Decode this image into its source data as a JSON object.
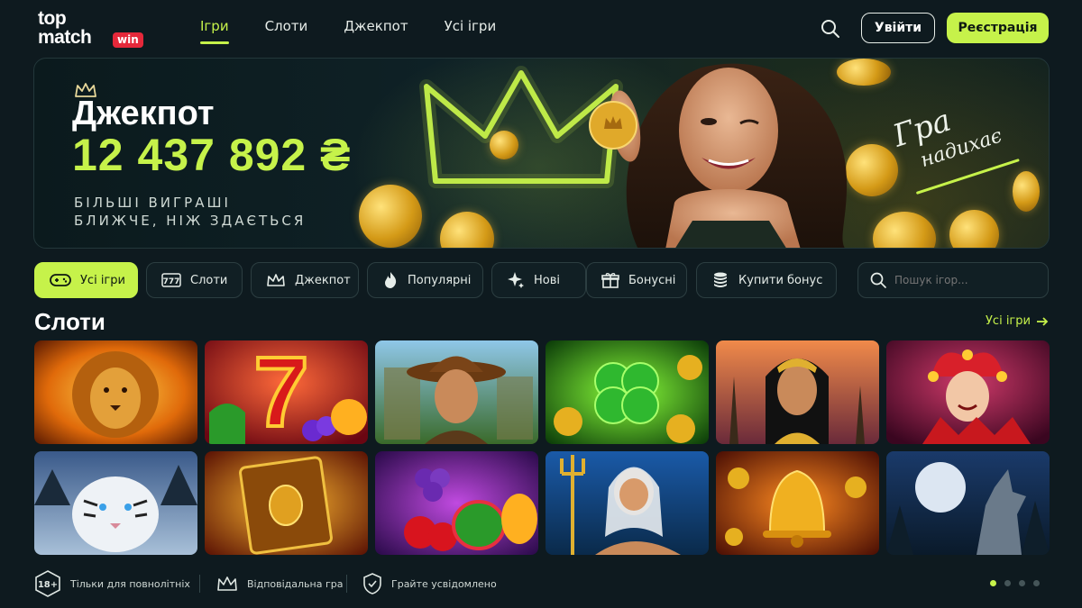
{
  "brand": {
    "top": "top",
    "bottom": "match",
    "badge": "win"
  },
  "nav": [
    {
      "label": "Ігри",
      "active": true
    },
    {
      "label": "Слоти",
      "active": false
    },
    {
      "label": "Джекпот",
      "active": false
    },
    {
      "label": "Усі ігри",
      "active": false
    }
  ],
  "header": {
    "login": "Увійти",
    "register": "Реєстрація"
  },
  "hero": {
    "title": "Джекпот",
    "amount": "12 437 892 ₴",
    "subtitle_line1": "БІЛЬШІ ВИГРАШІ",
    "subtitle_line2": "БЛИЖЧЕ, НІЖ ЗДАЄТЬСЯ",
    "tagline_line1": "Гра",
    "tagline_line2": "надихає"
  },
  "filters": [
    {
      "label": "Усі ігри",
      "icon": "gamepad-icon",
      "active": true
    },
    {
      "label": "Слоти",
      "icon": "slot-777-icon",
      "active": false
    },
    {
      "label": "Джекпот",
      "icon": "crown-icon",
      "active": false
    },
    {
      "label": "Популярні",
      "icon": "flame-icon",
      "active": false
    },
    {
      "label": "Нові",
      "icon": "sparkle-icon",
      "active": false
    },
    {
      "label": "Бонусні",
      "icon": "gift-icon",
      "active": false
    },
    {
      "label": "Купити бонус",
      "icon": "coins-stack-icon",
      "active": false
    }
  ],
  "search": {
    "placeholder": "Пошук ігор..."
  },
  "section": {
    "title": "Слоти",
    "see_all": "Усі ігри"
  },
  "games": [
    {
      "name": "lion-slot"
    },
    {
      "name": "lucky-seven-slot"
    },
    {
      "name": "explorer-slot"
    },
    {
      "name": "clover-slot"
    },
    {
      "name": "cleopatra-slot"
    },
    {
      "name": "jester-slot"
    },
    {
      "name": "white-tiger-slot"
    },
    {
      "name": "book-slot"
    },
    {
      "name": "fruits-slot"
    },
    {
      "name": "poseidon-slot"
    },
    {
      "name": "golden-bell-slot"
    },
    {
      "name": "wolf-moon-slot"
    }
  ],
  "footer": {
    "age_badge": "18+",
    "adults_only": "Тільки для повнолітніх",
    "responsible": "Відповідальна гра",
    "mindful": "Грайте усвідомлено"
  },
  "pagination": {
    "pages": 4,
    "active_index": 0
  },
  "colors": {
    "accent": "#c6f24a",
    "background": "#0e1a1f",
    "brand_red": "#e5283a"
  }
}
